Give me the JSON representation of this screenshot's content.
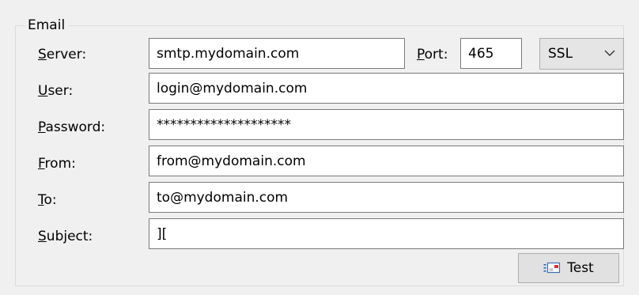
{
  "group": {
    "title": "Email"
  },
  "labels": {
    "server": {
      "accel": "S",
      "rest": "erver:"
    },
    "port": {
      "accel": "P",
      "rest": "ort:"
    },
    "user": {
      "accel": "U",
      "rest": "ser:"
    },
    "password": {
      "accel": "P",
      "rest": "assword:"
    },
    "from": {
      "accel": "F",
      "rest": "rom:"
    },
    "to": {
      "accel": "T",
      "rest": "o:"
    },
    "subject": {
      "accel": "S",
      "rest": "ubject:"
    }
  },
  "fields": {
    "server": "smtp.mydomain.com",
    "port": "465",
    "security": "SSL",
    "user": "login@mydomain.com",
    "password": "********************",
    "from": "from@mydomain.com",
    "to": "to@mydomain.com",
    "subject": "]["
  },
  "buttons": {
    "test": "Test"
  },
  "icons": {
    "dropdown": "chevron-down-icon",
    "test": "mail-icon"
  }
}
